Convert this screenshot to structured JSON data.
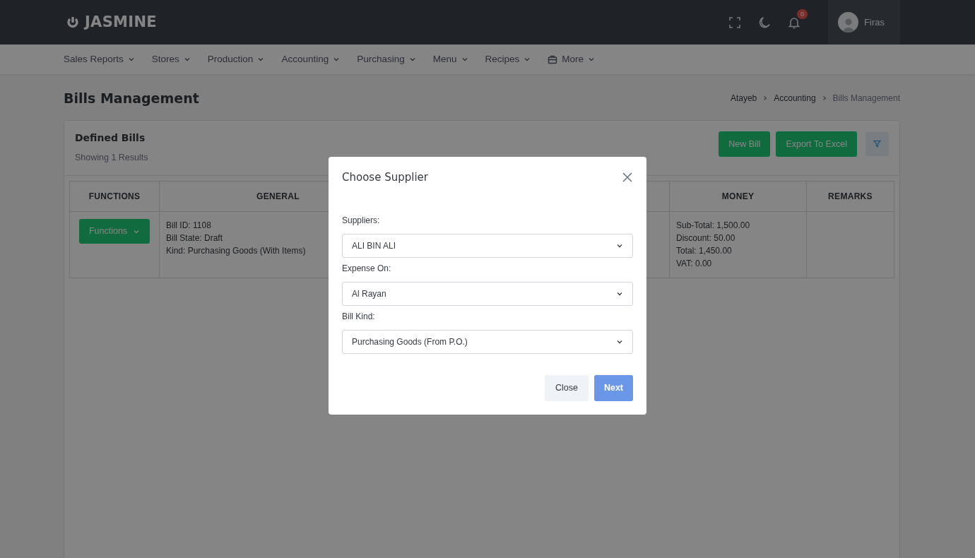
{
  "header": {
    "logo": "JASMINE",
    "notifications": "0",
    "user": "Firas"
  },
  "nav": [
    {
      "label": "Sales Reports",
      "icon": false
    },
    {
      "label": "Stores",
      "icon": false
    },
    {
      "label": "Production",
      "icon": false
    },
    {
      "label": "Accounting",
      "icon": false
    },
    {
      "label": "Purchasing",
      "icon": false
    },
    {
      "label": "Menu",
      "icon": false
    },
    {
      "label": "Recipes",
      "icon": false
    },
    {
      "label": "More",
      "icon": true
    }
  ],
  "page": {
    "title": "Bills Management",
    "breadcrumb": [
      "Atayeb",
      "Accounting",
      "Bills Management"
    ]
  },
  "card": {
    "title": "Defined Bills",
    "subtitle": "Showing 1 Results",
    "buttons": [
      "New Bill",
      "Export To Excel"
    ]
  },
  "table": {
    "columns": [
      "FUNCTIONS",
      "GENERAL",
      "MONEY",
      "REMARKS"
    ],
    "rows": [
      {
        "functions_button": "Functions",
        "general": [
          "Bill ID: 1108",
          "Bill State: Draft",
          "Kind: Purchasing Goods (With Items)"
        ],
        "money": [
          "Sub-Total: 1,500.00",
          "Discount: 50.00",
          "Total: 1,450.00",
          "VAT: 0.00"
        ]
      }
    ]
  },
  "modal": {
    "title": "Choose Supplier",
    "fields": [
      {
        "label": "Suppliers:",
        "value": "ALI BIN ALI"
      },
      {
        "label": "Expense On:",
        "value": "Al Rayan"
      },
      {
        "label": "Bill Kind:",
        "value": "Purchasing Goods (From P.O.)"
      }
    ],
    "buttons": [
      {
        "label": "Close",
        "kind": "secondary"
      },
      {
        "label": "Next",
        "kind": "primary"
      }
    ]
  }
}
